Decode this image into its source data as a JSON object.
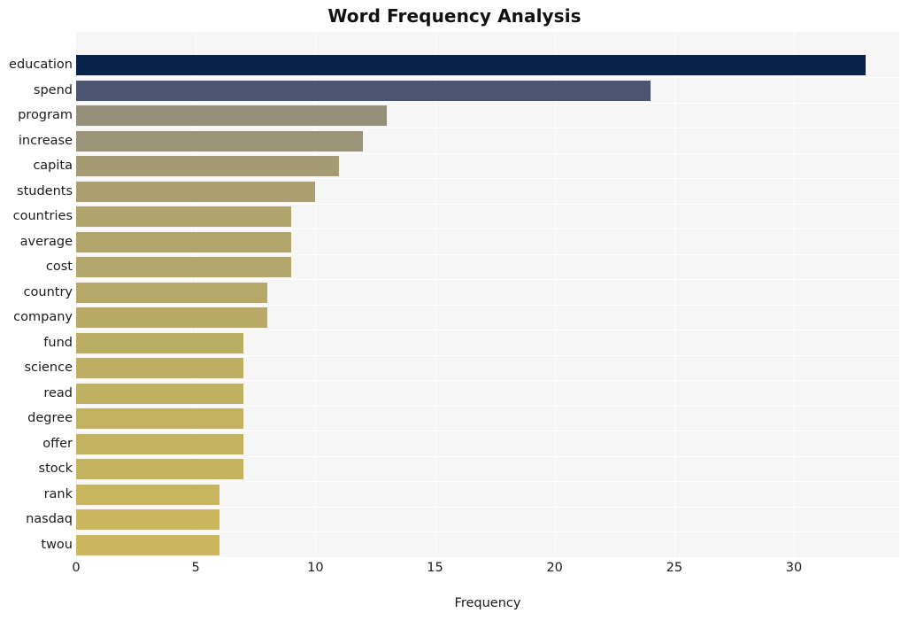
{
  "chart_data": {
    "type": "bar",
    "orientation": "horizontal",
    "title": "Word Frequency Analysis",
    "xlabel": "Frequency",
    "ylabel": "",
    "xlim": [
      0,
      34.4
    ],
    "xticks": [
      0,
      5,
      10,
      15,
      20,
      25,
      30
    ],
    "xticklabels": [
      "0",
      "5",
      "10",
      "15",
      "20",
      "25",
      "30"
    ],
    "grid": "vertical-white-on-light-gray",
    "legend": "none",
    "categories": [
      "education",
      "spend",
      "program",
      "increase",
      "capita",
      "students",
      "countries",
      "average",
      "cost",
      "country",
      "company",
      "fund",
      "science",
      "read",
      "degree",
      "offer",
      "stock",
      "rank",
      "nasdaq",
      "twou"
    ],
    "values": [
      33,
      24,
      13,
      12,
      11,
      10,
      9,
      9,
      9,
      8,
      8,
      7,
      7,
      7,
      7,
      7,
      7,
      6,
      6,
      6
    ],
    "bar_colors": [
      "#082249",
      "#4b5571",
      "#96907a",
      "#9b9478",
      "#a49a73",
      "#ab9f6f",
      "#b0a36c",
      "#b2a56b",
      "#b3a66a",
      "#b6a868",
      "#b8aa66",
      "#bcad64",
      "#bdae63",
      "#bfb062",
      "#c1b161",
      "#c3b360",
      "#c5b45f",
      "#c8b65e",
      "#cab75e",
      "#cbb75e"
    ],
    "colormap": "cividis-like (dark navy -> khaki gold)"
  },
  "figure": {
    "background": "#ffffff",
    "plot_background": "#f6f6f6",
    "gridline_color": "#ffffff",
    "text_color": "#1a1a1a"
  }
}
